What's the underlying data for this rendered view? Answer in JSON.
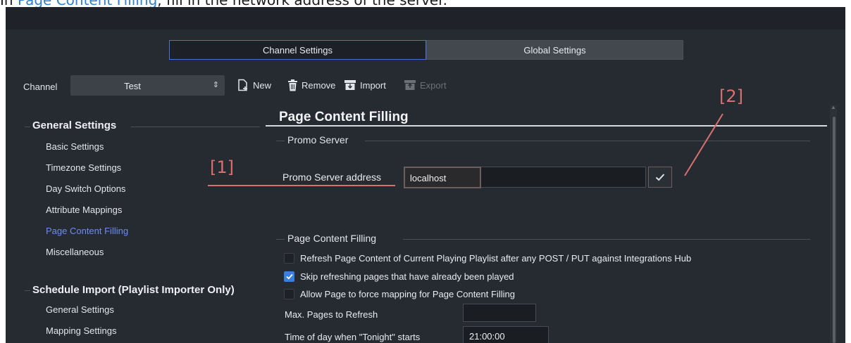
{
  "caption": {
    "prefix": "In ",
    "link": "Page Content Filling",
    "suffix": ", fill in the network address of the server."
  },
  "tabs": {
    "channel_settings": "Channel Settings",
    "global_settings": "Global Settings"
  },
  "channel": {
    "label": "Channel",
    "selected": "Test"
  },
  "toolbar": {
    "new": "New",
    "remove": "Remove",
    "import": "Import",
    "export": "Export"
  },
  "sidebar": {
    "general_title": "General Settings",
    "general_items": [
      "Basic Settings",
      "Timezone Settings",
      "Day Switch Options",
      "Attribute Mappings",
      "Page Content Filling",
      "Miscellaneous"
    ],
    "schedule_title": "Schedule Import (Playlist Importer Only)",
    "schedule_items": [
      "General Settings",
      "Mapping Settings"
    ]
  },
  "main": {
    "title": "Page Content Filling",
    "promo_fieldset": "Promo Server",
    "promo_address_label": "Promo Server address",
    "promo_address_value": "localhost",
    "pcf_fieldset": "Page Content Filling",
    "checkboxes": [
      {
        "label": "Refresh Page Content of Current Playing Playlist after any POST / PUT against Integrations Hub",
        "checked": false
      },
      {
        "label": "Skip refreshing pages that have already been played",
        "checked": true
      },
      {
        "label": "Allow Page to force mapping for Page Content Filling",
        "checked": false
      }
    ],
    "max_pages_label": "Max. Pages to Refresh",
    "max_pages_value": "",
    "tonight_label": "Time of day when \"Tonight\" starts",
    "tonight_value": "21:00:00"
  },
  "annotations": {
    "one": "[1]",
    "two": "[2]"
  },
  "colors": {
    "accent": "#6b8ef0",
    "annotation": "#d8706f",
    "background": "#262a31",
    "checkbox_checked": "#3b7fdc"
  },
  "icons": [
    "new-page-icon",
    "trash-icon",
    "import-icon",
    "export-icon",
    "checkmark-icon",
    "dropdown-arrows-icon"
  ]
}
